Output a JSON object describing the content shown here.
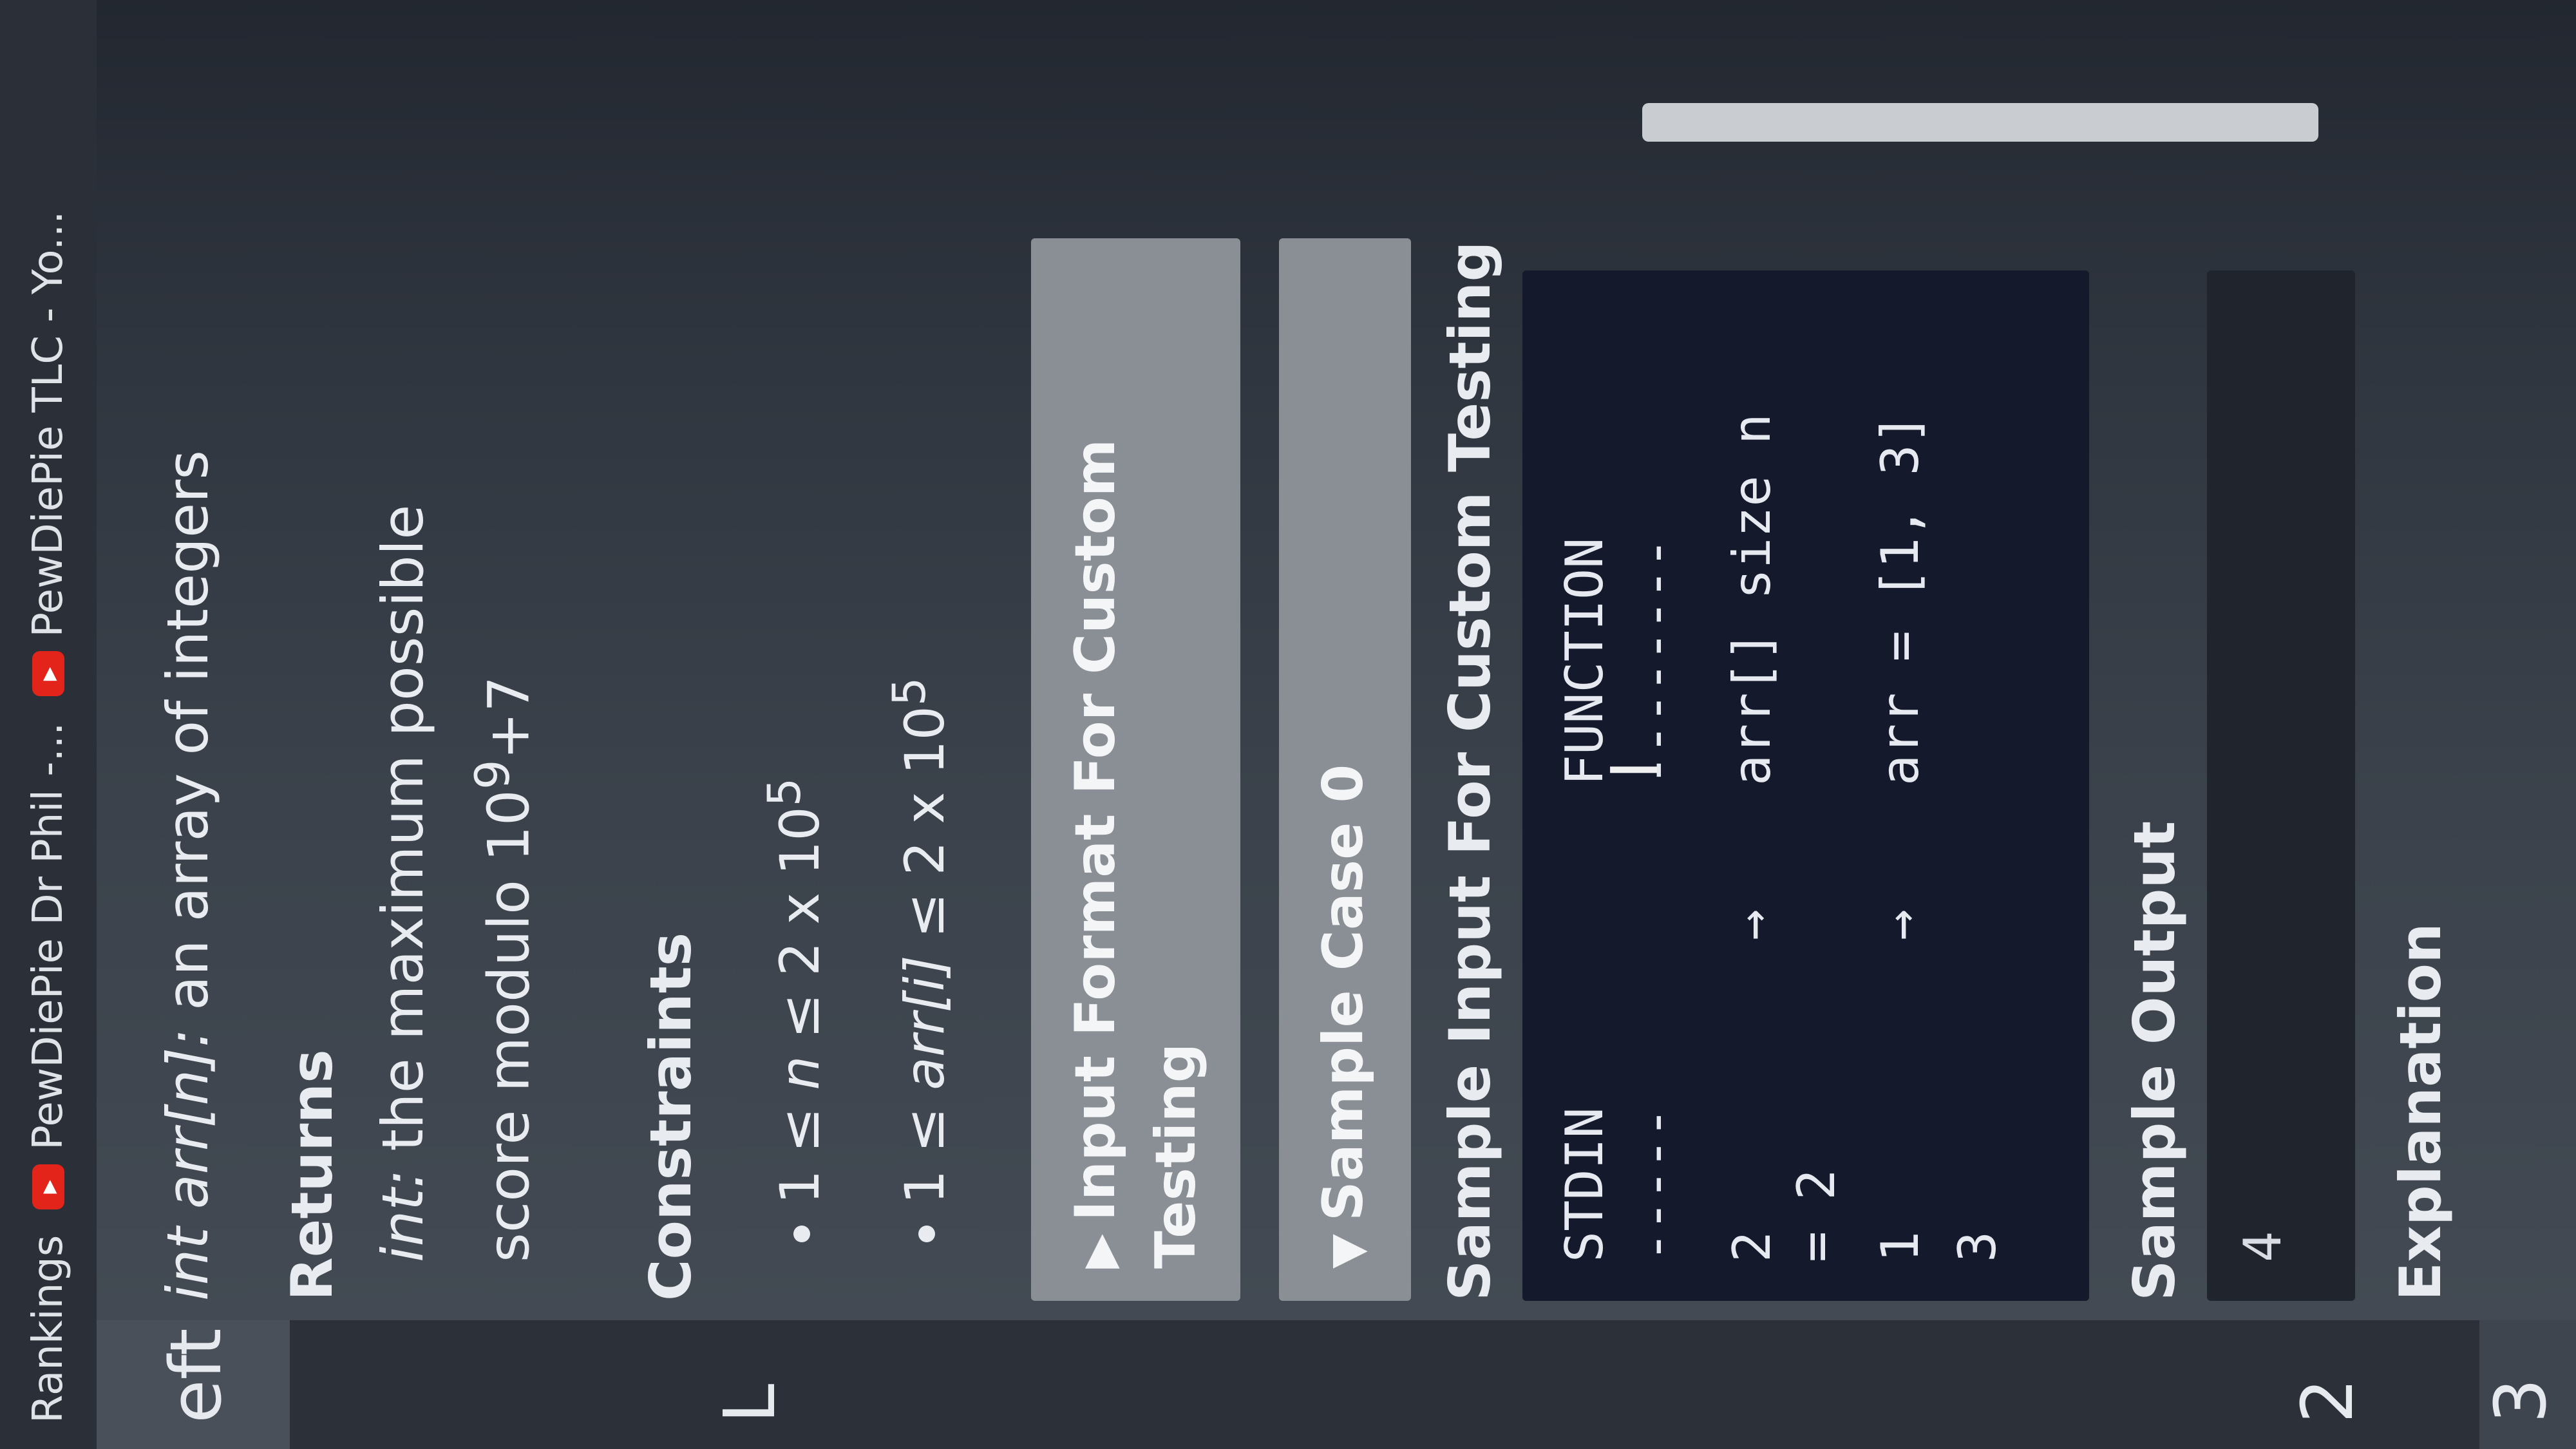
{
  "bookmarks": [
    {
      "label": "Rankings",
      "icon": "none"
    },
    {
      "label": "PewDiePie Dr Phil -...",
      "icon": "youtube-icon"
    },
    {
      "label": "PewDiePie TLC - Yo...",
      "icon": "youtube-icon"
    }
  ],
  "left_panel": {
    "items": [
      "eft",
      "L",
      "2",
      "3"
    ]
  },
  "problem": {
    "param_type": "int arr[n]:",
    "param_desc": " an array of integers",
    "returns_heading": "Returns",
    "returns_type": "int:",
    "returns_text": " the maximum possible score modulo 10",
    "returns_exp": "9",
    "returns_tail": "+7",
    "constraints_heading": "Constraints",
    "constraint_1_prefix": "1 ≤ ",
    "constraint_1_var": "n",
    "constraint_1_suffix": " ≤ 2 x 10",
    "constraint_1_exp": "5",
    "constraint_2_prefix": "1 ≤ ",
    "constraint_2_var": "arr[i]",
    "constraint_2_suffix": " ≤ 2 x 10",
    "constraint_2_exp": "5"
  },
  "accordions": {
    "input_format": "Input Format For Custom Testing",
    "sample_case": "Sample Case 0"
  },
  "sample_input": {
    "heading": "Sample Input For Custom Testing",
    "header_stdin": "STDIN",
    "header_function": "FUNCTION",
    "dash_stdin": "-----",
    "dash_function": "--------",
    "row1_stdin": "2",
    "row1_arrow": "→",
    "row1_function": "arr[] size n",
    "row1_cont": "= 2",
    "row2_stdin": "1",
    "row2_arrow": "→",
    "row2_function": "arr = [1, 3]",
    "row3_stdin": "3"
  },
  "sample_output": {
    "heading": "Sample Output",
    "value": "4"
  },
  "explanation": {
    "heading": "Explanation"
  },
  "colors": {
    "accent_youtube": "#e3241b",
    "code_bg": "#141a2b",
    "accordion_bg": "#8a8f96"
  }
}
